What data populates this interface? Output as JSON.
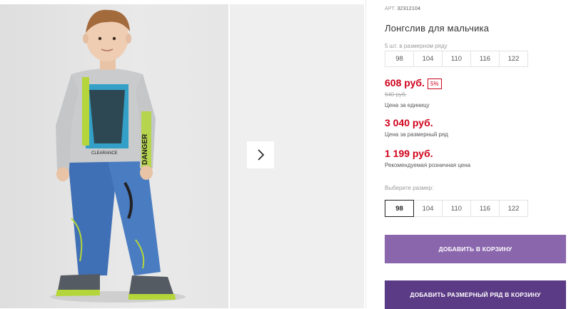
{
  "product": {
    "article_label": "АРТ.",
    "article": "32312104",
    "title": "Лонгслив для мальчика",
    "row_note": "5 шт. в размерном ряду",
    "row_sizes": [
      "98",
      "104",
      "110",
      "116",
      "122"
    ],
    "price": "608 руб.",
    "discount": "5%",
    "old_price": "640 руб.",
    "unit_caption": "Цена за единицу",
    "row_price": "3 040 руб.",
    "row_caption": "Цена за размерный ряд",
    "retail_price": "1 199 руб.",
    "retail_caption": "Рекомендуемая розничная цена",
    "choose_size_label": "Выберите размер:",
    "select_sizes": [
      "98",
      "104",
      "110",
      "116",
      "122"
    ],
    "selected_size": "98",
    "add_to_cart": "ДОБАВИТЬ В КОРЗИНУ",
    "add_row_to_cart": "ДОБАВИТЬ РАЗМЕРНЫЙ РЯД В КОРЗИНУ"
  },
  "gallery": {
    "next_icon": "chevron-right-icon",
    "shirt_print_side": "DANGER",
    "shirt_print_front": "CLEARANCE"
  },
  "colors": {
    "accent_red": "#d0021b",
    "button_primary": "#8a66ad",
    "button_secondary": "#5b3a86"
  }
}
